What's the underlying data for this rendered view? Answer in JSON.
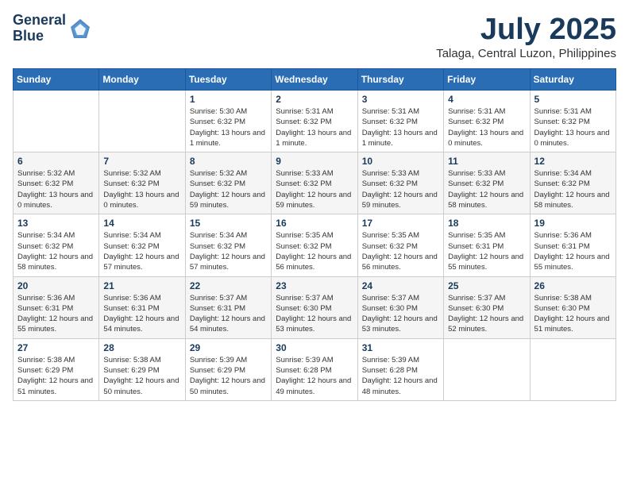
{
  "header": {
    "logo_line1": "General",
    "logo_line2": "Blue",
    "month": "July 2025",
    "location": "Talaga, Central Luzon, Philippines"
  },
  "weekdays": [
    "Sunday",
    "Monday",
    "Tuesday",
    "Wednesday",
    "Thursday",
    "Friday",
    "Saturday"
  ],
  "weeks": [
    [
      {
        "day": "",
        "info": ""
      },
      {
        "day": "",
        "info": ""
      },
      {
        "day": "1",
        "info": "Sunrise: 5:30 AM\nSunset: 6:32 PM\nDaylight: 13 hours and 1 minute."
      },
      {
        "day": "2",
        "info": "Sunrise: 5:31 AM\nSunset: 6:32 PM\nDaylight: 13 hours and 1 minute."
      },
      {
        "day": "3",
        "info": "Sunrise: 5:31 AM\nSunset: 6:32 PM\nDaylight: 13 hours and 1 minute."
      },
      {
        "day": "4",
        "info": "Sunrise: 5:31 AM\nSunset: 6:32 PM\nDaylight: 13 hours and 0 minutes."
      },
      {
        "day": "5",
        "info": "Sunrise: 5:31 AM\nSunset: 6:32 PM\nDaylight: 13 hours and 0 minutes."
      }
    ],
    [
      {
        "day": "6",
        "info": "Sunrise: 5:32 AM\nSunset: 6:32 PM\nDaylight: 13 hours and 0 minutes."
      },
      {
        "day": "7",
        "info": "Sunrise: 5:32 AM\nSunset: 6:32 PM\nDaylight: 13 hours and 0 minutes."
      },
      {
        "day": "8",
        "info": "Sunrise: 5:32 AM\nSunset: 6:32 PM\nDaylight: 12 hours and 59 minutes."
      },
      {
        "day": "9",
        "info": "Sunrise: 5:33 AM\nSunset: 6:32 PM\nDaylight: 12 hours and 59 minutes."
      },
      {
        "day": "10",
        "info": "Sunrise: 5:33 AM\nSunset: 6:32 PM\nDaylight: 12 hours and 59 minutes."
      },
      {
        "day": "11",
        "info": "Sunrise: 5:33 AM\nSunset: 6:32 PM\nDaylight: 12 hours and 58 minutes."
      },
      {
        "day": "12",
        "info": "Sunrise: 5:34 AM\nSunset: 6:32 PM\nDaylight: 12 hours and 58 minutes."
      }
    ],
    [
      {
        "day": "13",
        "info": "Sunrise: 5:34 AM\nSunset: 6:32 PM\nDaylight: 12 hours and 58 minutes."
      },
      {
        "day": "14",
        "info": "Sunrise: 5:34 AM\nSunset: 6:32 PM\nDaylight: 12 hours and 57 minutes."
      },
      {
        "day": "15",
        "info": "Sunrise: 5:34 AM\nSunset: 6:32 PM\nDaylight: 12 hours and 57 minutes."
      },
      {
        "day": "16",
        "info": "Sunrise: 5:35 AM\nSunset: 6:32 PM\nDaylight: 12 hours and 56 minutes."
      },
      {
        "day": "17",
        "info": "Sunrise: 5:35 AM\nSunset: 6:32 PM\nDaylight: 12 hours and 56 minutes."
      },
      {
        "day": "18",
        "info": "Sunrise: 5:35 AM\nSunset: 6:31 PM\nDaylight: 12 hours and 55 minutes."
      },
      {
        "day": "19",
        "info": "Sunrise: 5:36 AM\nSunset: 6:31 PM\nDaylight: 12 hours and 55 minutes."
      }
    ],
    [
      {
        "day": "20",
        "info": "Sunrise: 5:36 AM\nSunset: 6:31 PM\nDaylight: 12 hours and 55 minutes."
      },
      {
        "day": "21",
        "info": "Sunrise: 5:36 AM\nSunset: 6:31 PM\nDaylight: 12 hours and 54 minutes."
      },
      {
        "day": "22",
        "info": "Sunrise: 5:37 AM\nSunset: 6:31 PM\nDaylight: 12 hours and 54 minutes."
      },
      {
        "day": "23",
        "info": "Sunrise: 5:37 AM\nSunset: 6:30 PM\nDaylight: 12 hours and 53 minutes."
      },
      {
        "day": "24",
        "info": "Sunrise: 5:37 AM\nSunset: 6:30 PM\nDaylight: 12 hours and 53 minutes."
      },
      {
        "day": "25",
        "info": "Sunrise: 5:37 AM\nSunset: 6:30 PM\nDaylight: 12 hours and 52 minutes."
      },
      {
        "day": "26",
        "info": "Sunrise: 5:38 AM\nSunset: 6:30 PM\nDaylight: 12 hours and 51 minutes."
      }
    ],
    [
      {
        "day": "27",
        "info": "Sunrise: 5:38 AM\nSunset: 6:29 PM\nDaylight: 12 hours and 51 minutes."
      },
      {
        "day": "28",
        "info": "Sunrise: 5:38 AM\nSunset: 6:29 PM\nDaylight: 12 hours and 50 minutes."
      },
      {
        "day": "29",
        "info": "Sunrise: 5:39 AM\nSunset: 6:29 PM\nDaylight: 12 hours and 50 minutes."
      },
      {
        "day": "30",
        "info": "Sunrise: 5:39 AM\nSunset: 6:28 PM\nDaylight: 12 hours and 49 minutes."
      },
      {
        "day": "31",
        "info": "Sunrise: 5:39 AM\nSunset: 6:28 PM\nDaylight: 12 hours and 48 minutes."
      },
      {
        "day": "",
        "info": ""
      },
      {
        "day": "",
        "info": ""
      }
    ]
  ]
}
